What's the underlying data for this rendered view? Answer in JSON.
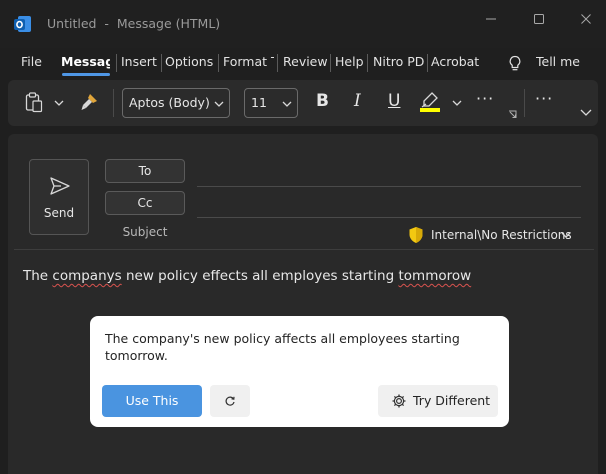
{
  "window": {
    "title_parts": [
      "Untitled",
      "-",
      "Message (HTML)"
    ],
    "controls": [
      "minimize",
      "maximize",
      "close"
    ]
  },
  "ribbon": {
    "tabs": [
      {
        "label": "File",
        "active": false
      },
      {
        "label": "Message",
        "active": true
      },
      {
        "label": "Insert",
        "active": false
      },
      {
        "label": "Options",
        "active": false
      },
      {
        "label": "Format T",
        "active": false
      },
      {
        "label": "Review",
        "active": false
      },
      {
        "label": "Help",
        "active": false
      },
      {
        "label": "Nitro PD",
        "active": false
      },
      {
        "label": "Acrobat",
        "active": false
      }
    ],
    "tell_me": "Tell me"
  },
  "toolbar": {
    "font_name": "Aptos (Body)",
    "font_size": "11",
    "bold": "B",
    "italic": "I",
    "underline": "U",
    "more": "···",
    "icons": [
      "clipboard-icon",
      "format-painter-icon",
      "highlighter-icon",
      "dialog-launcher-icon",
      "chevron-down-icon"
    ],
    "highlight_color": "#ffff00"
  },
  "compose": {
    "send_label": "Send",
    "to_label": "To",
    "cc_label": "Cc",
    "subject_label": "Subject",
    "sensitivity_label": "Internal\\No Restrictions",
    "body_segments": [
      {
        "text": "The ",
        "misspelled": false
      },
      {
        "text": "companys",
        "misspelled": true
      },
      {
        "text": " new policy effects all employes starting ",
        "misspelled": false
      },
      {
        "text": "tommorow",
        "misspelled": true
      }
    ]
  },
  "suggestion": {
    "text": "The company's new policy affects all employees starting tomorrow.",
    "use_label": "Use This",
    "retry_symbol": "↻",
    "try_label": "Try Different"
  },
  "colors": {
    "accent": "#4a94e0",
    "tab_indicator": "#4f97e6",
    "app_logo": "#1a73c8",
    "shield": "#f2c811"
  }
}
